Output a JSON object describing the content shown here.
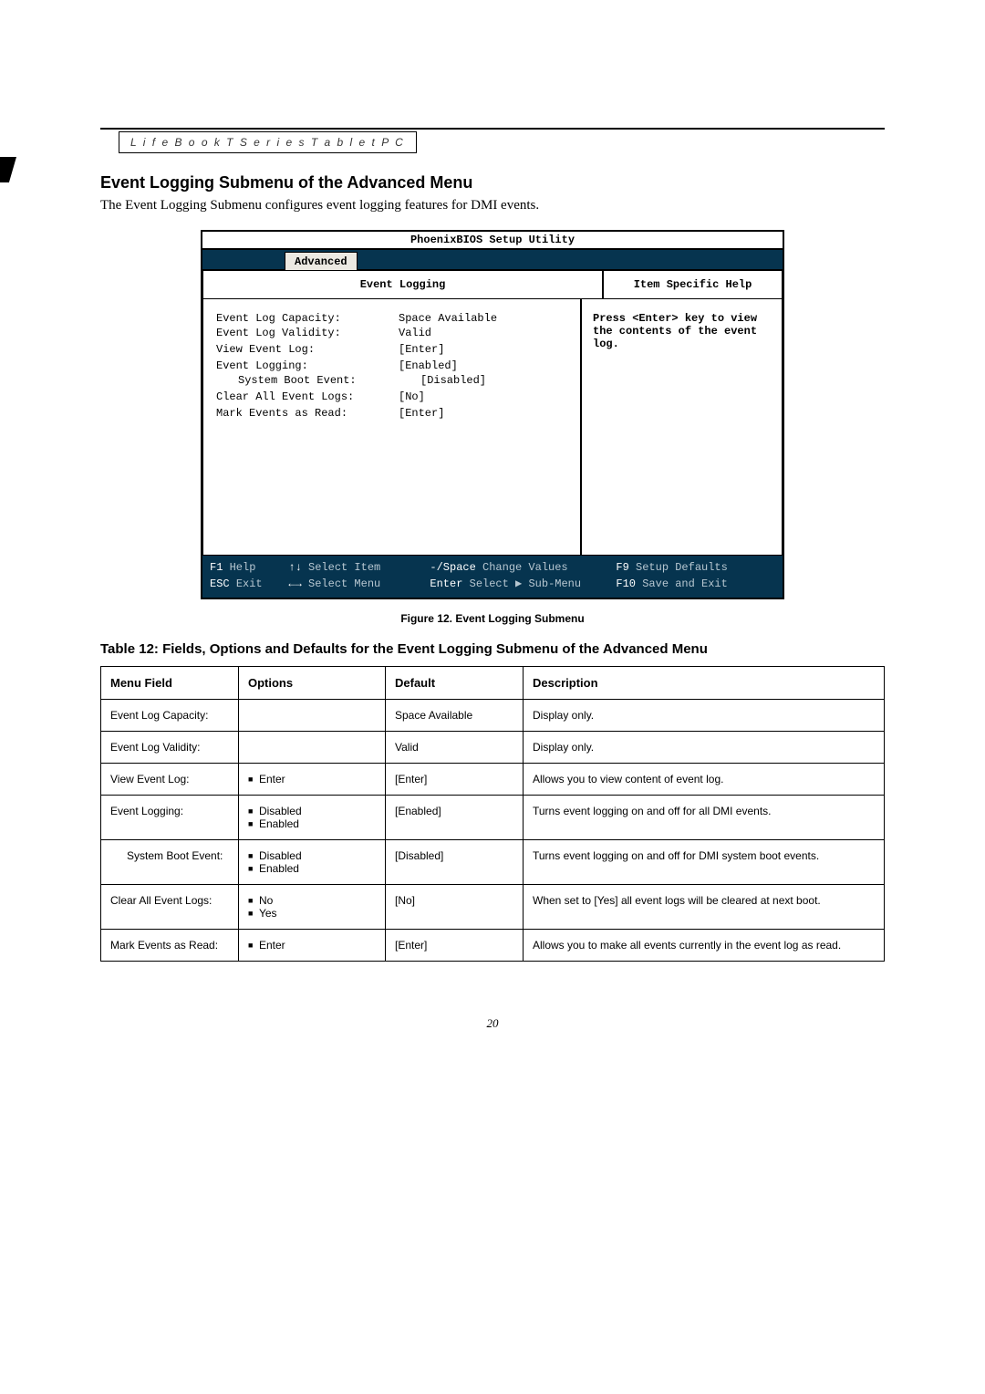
{
  "header": {
    "product": "L i f e B o o k   T   S e r i e s   T a b l e t   P C"
  },
  "section": {
    "title": "Event Logging Submenu of the Advanced Menu",
    "intro": "The Event Logging Submenu configures event logging features for DMI events."
  },
  "bios": {
    "title": "PhoenixBIOS Setup Utility",
    "active_tab": "Advanced",
    "left_head": "Event Logging",
    "right_head": "Item Specific Help",
    "help_text": "Press <Enter> key to view the contents of the event log.",
    "rows": [
      {
        "label": "Event Log Capacity:",
        "value": "Space Available",
        "indent": false
      },
      {
        "label": "Event Log Validity:",
        "value": "Valid",
        "indent": false
      },
      {
        "label": "",
        "value": "",
        "indent": false
      },
      {
        "label": "View Event Log:",
        "value": "[Enter]",
        "indent": false
      },
      {
        "label": "",
        "value": "",
        "indent": false
      },
      {
        "label": "Event Logging:",
        "value": "[Enabled]",
        "indent": false
      },
      {
        "label": "System Boot Event:",
        "value": "[Disabled]",
        "indent": true
      },
      {
        "label": "",
        "value": "",
        "indent": false
      },
      {
        "label": "Clear All Event Logs:",
        "value": "[No]",
        "indent": false
      },
      {
        "label": "",
        "value": "",
        "indent": false
      },
      {
        "label": "Mark Events as Read:",
        "value": "[Enter]",
        "indent": false
      }
    ],
    "footer": {
      "r1": [
        {
          "k": "F1",
          "l": "Help"
        },
        {
          "k": "↑↓",
          "l": "Select Item"
        },
        {
          "k": "-/Space",
          "l": "Change Values"
        },
        {
          "k": "F9",
          "l": "Setup Defaults"
        }
      ],
      "r2": [
        {
          "k": "ESC",
          "l": "Exit"
        },
        {
          "k": "←→",
          "l": "Select Menu"
        },
        {
          "k": "Enter",
          "l": "Select ▶ Sub-Menu"
        },
        {
          "k": "F10",
          "l": "Save and Exit"
        }
      ]
    }
  },
  "figure_caption": "Figure 12.   Event Logging Submenu",
  "table_title": "Table 12: Fields, Options and Defaults for the Event Logging Submenu of the Advanced Menu",
  "table": {
    "headers": {
      "menu": "Menu Field",
      "options": "Options",
      "def": "Default",
      "desc": "Description"
    },
    "rows": [
      {
        "menu": "Event Log Capacity:",
        "options": [],
        "def": "Space Available",
        "desc": "Display only.",
        "indent": false
      },
      {
        "menu": "Event Log Validity:",
        "options": [],
        "def": "Valid",
        "desc": "Display only.",
        "indent": false
      },
      {
        "menu": "View Event Log:",
        "options": [
          "Enter"
        ],
        "def": "[Enter]",
        "desc": "Allows you to view content of event log.",
        "indent": false
      },
      {
        "menu": "Event Logging:",
        "options": [
          "Disabled",
          "Enabled"
        ],
        "def": "[Enabled]",
        "desc": "Turns event logging on and off for all DMI events.",
        "indent": false
      },
      {
        "menu": "System Boot Event:",
        "options": [
          "Disabled",
          "Enabled"
        ],
        "def": "[Disabled]",
        "desc": "Turns event logging on and off for DMI system boot events.",
        "indent": true
      },
      {
        "menu": "Clear All Event Logs:",
        "options": [
          "No",
          "Yes"
        ],
        "def": "[No]",
        "desc": "When set to [Yes] all event logs will be cleared at next boot.",
        "indent": false
      },
      {
        "menu": "Mark Events as Read:",
        "options": [
          "Enter"
        ],
        "def": "[Enter]",
        "desc": "Allows you to make all events currently in the event log as read.",
        "indent": false
      }
    ]
  },
  "page_number": "20"
}
